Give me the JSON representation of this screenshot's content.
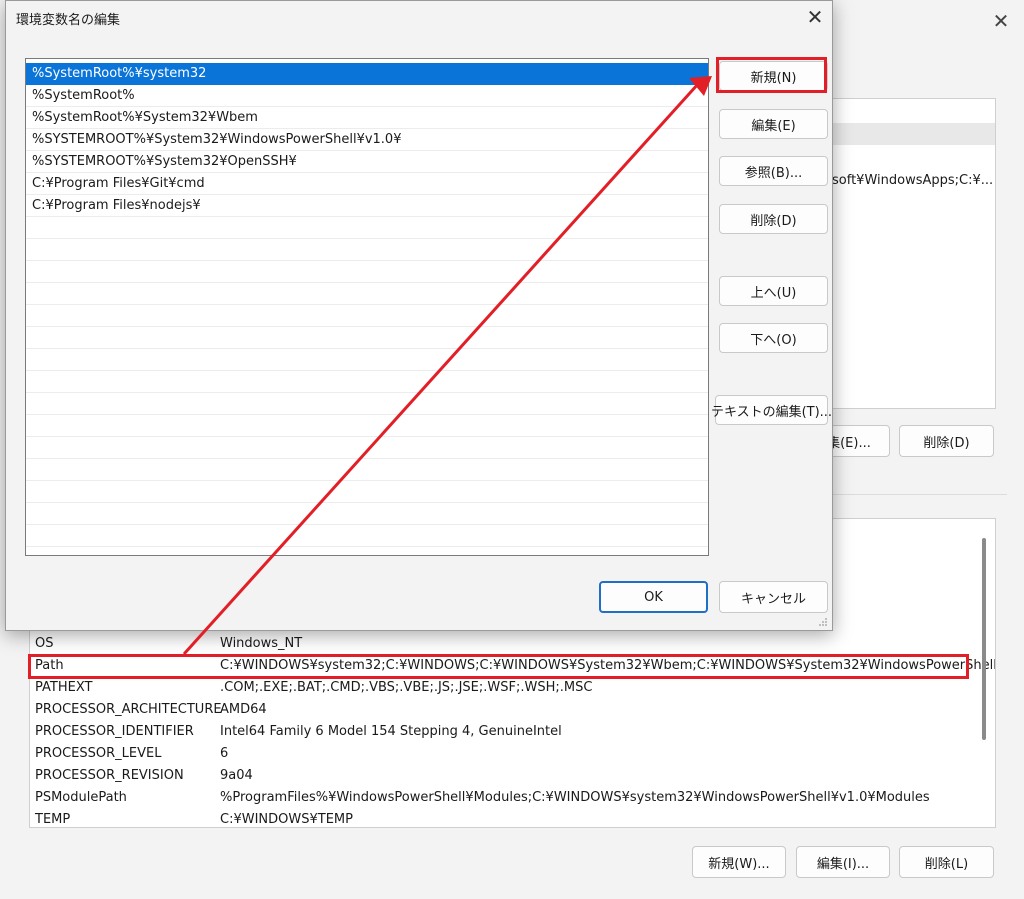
{
  "dialog": {
    "title": "環境変数名の編集",
    "path_entries": [
      "%SystemRoot%¥system32",
      "%SystemRoot%",
      "%SystemRoot%¥System32¥Wbem",
      "%SYSTEMROOT%¥System32¥WindowsPowerShell¥v1.0¥",
      "%SYSTEMROOT%¥System32¥OpenSSH¥",
      "C:¥Program Files¥Git¥cmd",
      "C:¥Program Files¥nodejs¥"
    ],
    "selected_index": 0,
    "buttons": {
      "new": "新規(N)",
      "edit": "編集(E)",
      "browse": "参照(B)...",
      "delete": "削除(D)",
      "move_up": "上へ(U)",
      "move_down": "下へ(O)",
      "edit_text": "テキストの編集(T)...",
      "ok": "OK",
      "cancel": "キャンセル"
    },
    "close_glyph": "✕"
  },
  "back_window": {
    "close_glyph": "✕",
    "user_vars_value_fragment": "soft¥WindowsApps;C:¥...",
    "user_buttons": {
      "edit": "集(E)...",
      "delete": "削除(D)"
    },
    "system_vars": [
      {
        "name": "OS",
        "value": "Windows_NT"
      },
      {
        "name": "Path",
        "value": "C:¥WINDOWS¥system32;C:¥WINDOWS;C:¥WINDOWS¥System32¥Wbem;C:¥WINDOWS¥System32¥WindowsPowerShell..."
      },
      {
        "name": "PATHEXT",
        "value": ".COM;.EXE;.BAT;.CMD;.VBS;.VBE;.JS;.JSE;.WSF;.WSH;.MSC"
      },
      {
        "name": "PROCESSOR_ARCHITECTURE",
        "value": "AMD64"
      },
      {
        "name": "PROCESSOR_IDENTIFIER",
        "value": "Intel64 Family 6 Model 154 Stepping 4, GenuineIntel"
      },
      {
        "name": "PROCESSOR_LEVEL",
        "value": "6"
      },
      {
        "name": "PROCESSOR_REVISION",
        "value": "9a04"
      },
      {
        "name": "PSModulePath",
        "value": "%ProgramFiles%¥WindowsPowerShell¥Modules;C:¥WINDOWS¥system32¥WindowsPowerShell¥v1.0¥Modules"
      },
      {
        "name": "TEMP",
        "value": "C:¥WINDOWS¥TEMP"
      }
    ],
    "system_buttons": {
      "new": "新規(W)...",
      "edit": "編集(I)...",
      "delete": "削除(L)"
    }
  },
  "colors": {
    "selection": "#0a74d9",
    "annotation": "#e21f26"
  },
  "icons": {
    "resize_grip": "resize-grip-icon"
  }
}
